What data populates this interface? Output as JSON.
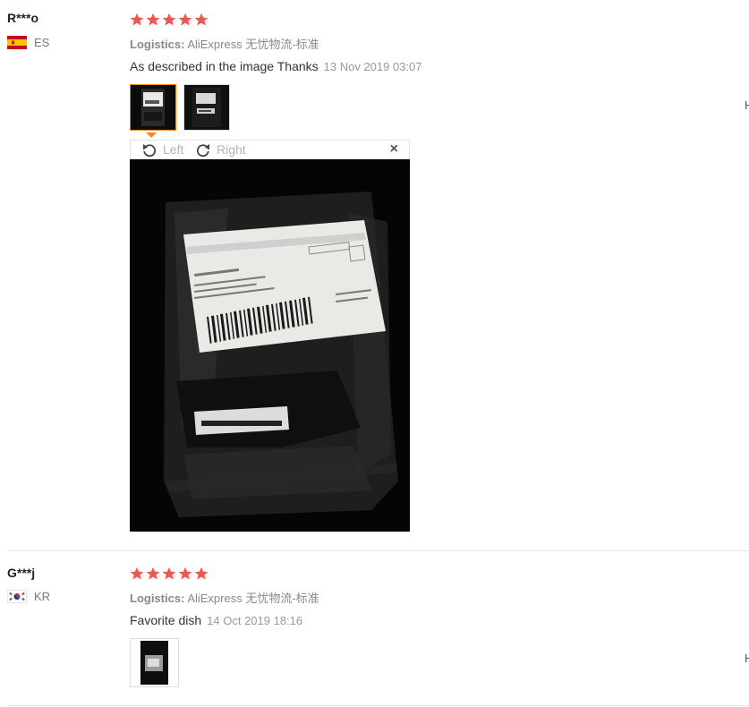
{
  "colors": {
    "star": "#f05550",
    "accent": "#f08a24",
    "separator": "#e5e5e5"
  },
  "reviews": [
    {
      "user": "R***o",
      "country": "ES",
      "flag_icon": "spain-flag-icon",
      "rating": 5,
      "logistics_label": "Logistics:",
      "logistics_value": "AliExpress 无忧物流-标准",
      "feedback": "As described in the image Thanks",
      "date": "13 Nov 2019 03:07",
      "edge_text": "H"
    },
    {
      "user": "G***j",
      "country": "KR",
      "flag_icon": "south-korea-flag-icon",
      "rating": 5,
      "logistics_label": "Logistics:",
      "logistics_value": "AliExpress 无忧物流-标准",
      "feedback": "Favorite dish",
      "date": "14 Oct 2019 18:16",
      "edge_text": "H"
    }
  ],
  "viewer": {
    "rotate_left_label": "Left",
    "rotate_right_label": "Right",
    "close_label": "×",
    "rotate_left_icon": "rotate-left-icon",
    "rotate_right_icon": "rotate-right-icon",
    "close_icon": "close-icon"
  }
}
